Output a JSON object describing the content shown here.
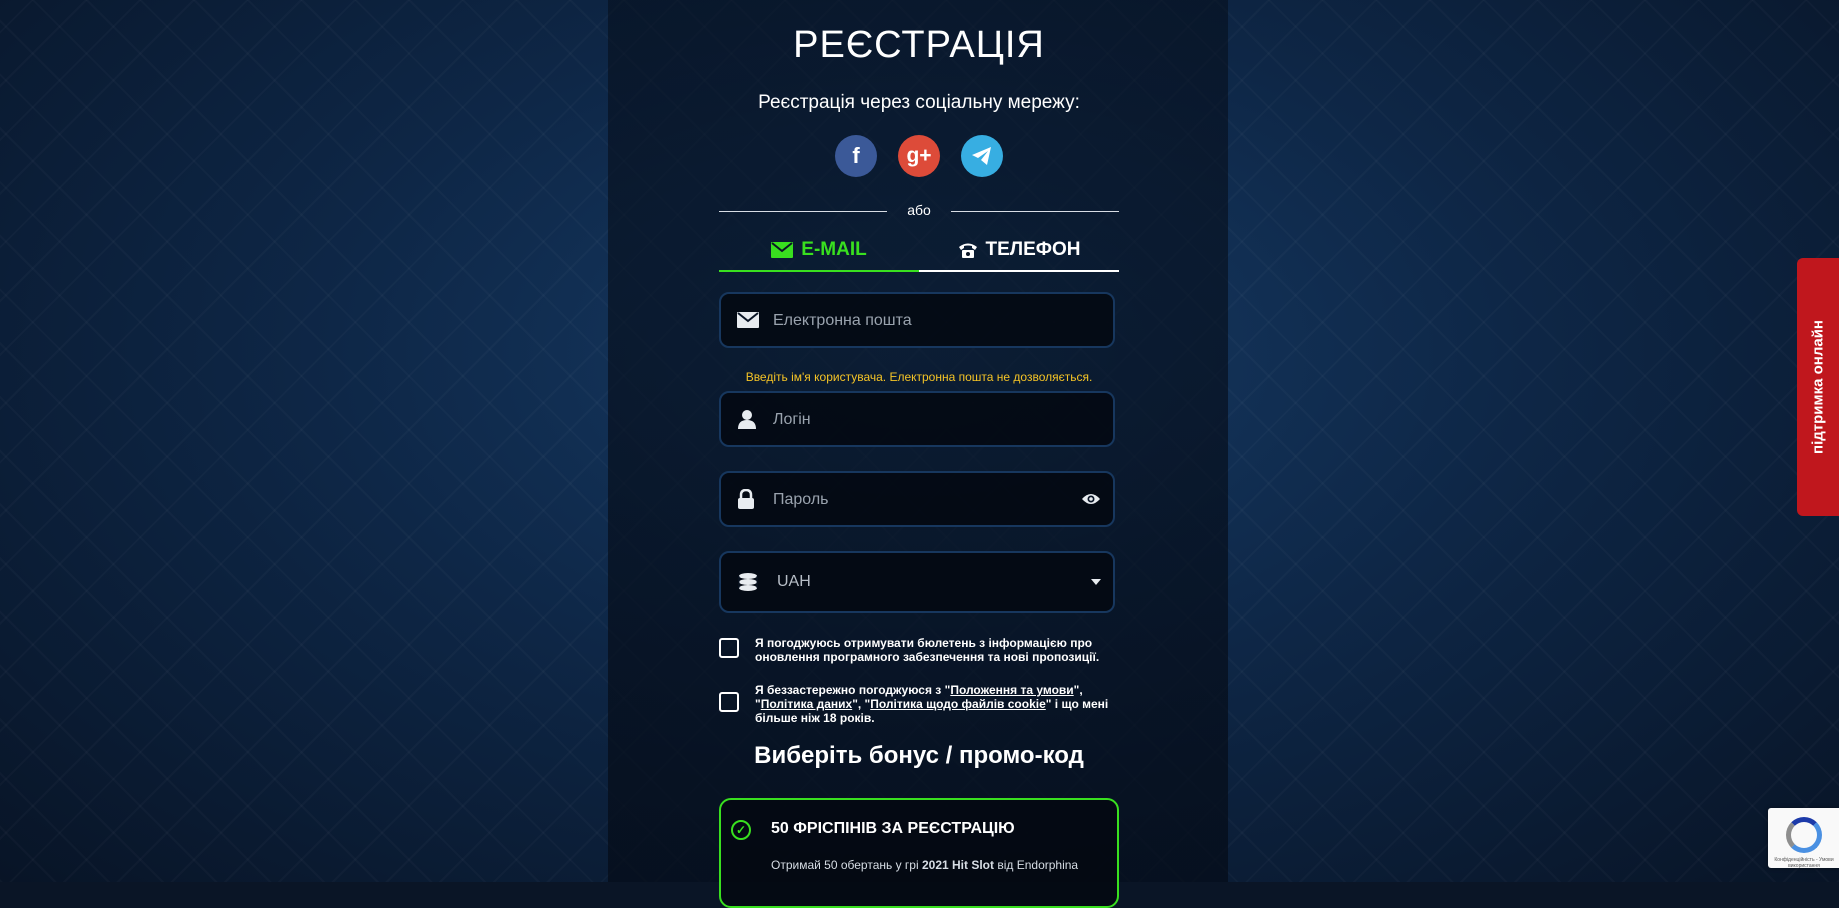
{
  "page": {
    "title": "РЕЄСТРАЦІЯ",
    "social_label": "Реєстрація через соціальну мережу:",
    "social": [
      {
        "name": "facebook",
        "glyph": "f",
        "color": "#3b5998"
      },
      {
        "name": "google-plus",
        "glyph": "g+",
        "color": "#dd4b39"
      },
      {
        "name": "telegram",
        "color": "#37aee2"
      }
    ],
    "divider_text": "або"
  },
  "tabs": [
    {
      "label": "E-MAIL",
      "icon": "envelope-icon",
      "active": true,
      "color": "#39e01f"
    },
    {
      "label": "ТЕЛЕФОН",
      "icon": "phone-icon",
      "active": false
    }
  ],
  "fields": {
    "email_placeholder": "Електронна пошта",
    "hint": "Введіть ім'я користувача. Електронна пошта не дозволяється.",
    "login_placeholder": "Логін",
    "password_placeholder": "Пароль",
    "currency_value": "UAH"
  },
  "checks": {
    "newsletter": "Я погоджуюсь отримувати бюлетень з інформацією про оновлення програмного забезпечення та нові пропозиції.",
    "terms_prefix": "Я беззастережно погоджуюся з \"",
    "terms_link1": "Положення та умови",
    "terms_sep1": "\", \"",
    "terms_link2": "Політика даних",
    "terms_sep2": "\", \"",
    "terms_link3": "Політика щодо файлів cookie",
    "terms_suffix": "\" і що мені більше ніж 18 років."
  },
  "bonus": {
    "title": "Виберіть бонус / промо-код",
    "card_name": "50 ФРІСПІНІВ ЗА РЕЄСТРАЦІЮ",
    "card_desc_prefix": "Отримай 50 обертань у грі ",
    "card_desc_game": "2021 Hit Slot",
    "card_desc_suffix": " від Endorphina"
  },
  "support": {
    "label": "підтримка онлайн",
    "color": "#c0171d"
  },
  "recaptcha": {
    "text": "Конфіденційність - Умови використання"
  }
}
